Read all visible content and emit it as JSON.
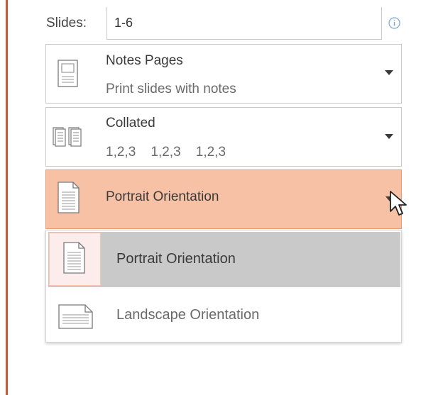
{
  "slides": {
    "label": "Slides:",
    "value": "1-6",
    "info_icon": "info-icon"
  },
  "layout_dropdown": {
    "title": "Notes Pages",
    "subtitle": "Print slides with notes",
    "icon": "notes-page-icon"
  },
  "collation_dropdown": {
    "title": "Collated",
    "subtitle": "1,2,3    1,2,3    1,2,3",
    "icon": "collated-pages-icon"
  },
  "orientation_dropdown": {
    "title": "Portrait Orientation",
    "icon": "portrait-page-icon",
    "highlight_color": "#f7c1a5"
  },
  "orientation_menu": {
    "items": [
      {
        "label": "Portrait Orientation",
        "icon": "portrait-page-icon",
        "selected": true
      },
      {
        "label": "Landscape Orientation",
        "icon": "landscape-page-icon",
        "selected": false
      }
    ]
  },
  "colors": {
    "accent": "#c55a3a",
    "selected_item": "#c9c9c9"
  }
}
